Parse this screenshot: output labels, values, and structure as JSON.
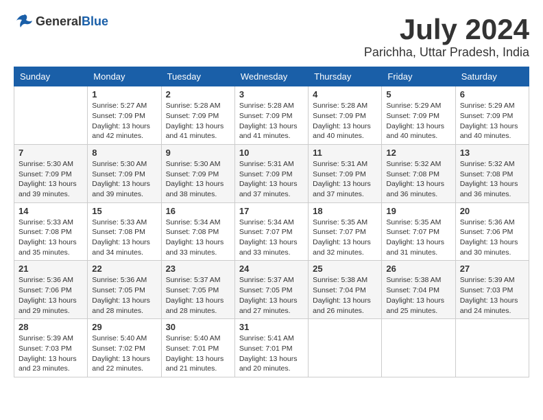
{
  "header": {
    "logo_general": "General",
    "logo_blue": "Blue",
    "month_year": "July 2024",
    "location": "Parichha, Uttar Pradesh, India"
  },
  "days_of_week": [
    "Sunday",
    "Monday",
    "Tuesday",
    "Wednesday",
    "Thursday",
    "Friday",
    "Saturday"
  ],
  "weeks": [
    [
      {
        "date": "",
        "sunrise": "",
        "sunset": "",
        "daylight": ""
      },
      {
        "date": "1",
        "sunrise": "Sunrise: 5:27 AM",
        "sunset": "Sunset: 7:09 PM",
        "daylight": "Daylight: 13 hours and 42 minutes."
      },
      {
        "date": "2",
        "sunrise": "Sunrise: 5:28 AM",
        "sunset": "Sunset: 7:09 PM",
        "daylight": "Daylight: 13 hours and 41 minutes."
      },
      {
        "date": "3",
        "sunrise": "Sunrise: 5:28 AM",
        "sunset": "Sunset: 7:09 PM",
        "daylight": "Daylight: 13 hours and 41 minutes."
      },
      {
        "date": "4",
        "sunrise": "Sunrise: 5:28 AM",
        "sunset": "Sunset: 7:09 PM",
        "daylight": "Daylight: 13 hours and 40 minutes."
      },
      {
        "date": "5",
        "sunrise": "Sunrise: 5:29 AM",
        "sunset": "Sunset: 7:09 PM",
        "daylight": "Daylight: 13 hours and 40 minutes."
      },
      {
        "date": "6",
        "sunrise": "Sunrise: 5:29 AM",
        "sunset": "Sunset: 7:09 PM",
        "daylight": "Daylight: 13 hours and 40 minutes."
      }
    ],
    [
      {
        "date": "7",
        "sunrise": "Sunrise: 5:30 AM",
        "sunset": "Sunset: 7:09 PM",
        "daylight": "Daylight: 13 hours and 39 minutes."
      },
      {
        "date": "8",
        "sunrise": "Sunrise: 5:30 AM",
        "sunset": "Sunset: 7:09 PM",
        "daylight": "Daylight: 13 hours and 39 minutes."
      },
      {
        "date": "9",
        "sunrise": "Sunrise: 5:30 AM",
        "sunset": "Sunset: 7:09 PM",
        "daylight": "Daylight: 13 hours and 38 minutes."
      },
      {
        "date": "10",
        "sunrise": "Sunrise: 5:31 AM",
        "sunset": "Sunset: 7:09 PM",
        "daylight": "Daylight: 13 hours and 37 minutes."
      },
      {
        "date": "11",
        "sunrise": "Sunrise: 5:31 AM",
        "sunset": "Sunset: 7:09 PM",
        "daylight": "Daylight: 13 hours and 37 minutes."
      },
      {
        "date": "12",
        "sunrise": "Sunrise: 5:32 AM",
        "sunset": "Sunset: 7:08 PM",
        "daylight": "Daylight: 13 hours and 36 minutes."
      },
      {
        "date": "13",
        "sunrise": "Sunrise: 5:32 AM",
        "sunset": "Sunset: 7:08 PM",
        "daylight": "Daylight: 13 hours and 36 minutes."
      }
    ],
    [
      {
        "date": "14",
        "sunrise": "Sunrise: 5:33 AM",
        "sunset": "Sunset: 7:08 PM",
        "daylight": "Daylight: 13 hours and 35 minutes."
      },
      {
        "date": "15",
        "sunrise": "Sunrise: 5:33 AM",
        "sunset": "Sunset: 7:08 PM",
        "daylight": "Daylight: 13 hours and 34 minutes."
      },
      {
        "date": "16",
        "sunrise": "Sunrise: 5:34 AM",
        "sunset": "Sunset: 7:08 PM",
        "daylight": "Daylight: 13 hours and 33 minutes."
      },
      {
        "date": "17",
        "sunrise": "Sunrise: 5:34 AM",
        "sunset": "Sunset: 7:07 PM",
        "daylight": "Daylight: 13 hours and 33 minutes."
      },
      {
        "date": "18",
        "sunrise": "Sunrise: 5:35 AM",
        "sunset": "Sunset: 7:07 PM",
        "daylight": "Daylight: 13 hours and 32 minutes."
      },
      {
        "date": "19",
        "sunrise": "Sunrise: 5:35 AM",
        "sunset": "Sunset: 7:07 PM",
        "daylight": "Daylight: 13 hours and 31 minutes."
      },
      {
        "date": "20",
        "sunrise": "Sunrise: 5:36 AM",
        "sunset": "Sunset: 7:06 PM",
        "daylight": "Daylight: 13 hours and 30 minutes."
      }
    ],
    [
      {
        "date": "21",
        "sunrise": "Sunrise: 5:36 AM",
        "sunset": "Sunset: 7:06 PM",
        "daylight": "Daylight: 13 hours and 29 minutes."
      },
      {
        "date": "22",
        "sunrise": "Sunrise: 5:36 AM",
        "sunset": "Sunset: 7:05 PM",
        "daylight": "Daylight: 13 hours and 28 minutes."
      },
      {
        "date": "23",
        "sunrise": "Sunrise: 5:37 AM",
        "sunset": "Sunset: 7:05 PM",
        "daylight": "Daylight: 13 hours and 28 minutes."
      },
      {
        "date": "24",
        "sunrise": "Sunrise: 5:37 AM",
        "sunset": "Sunset: 7:05 PM",
        "daylight": "Daylight: 13 hours and 27 minutes."
      },
      {
        "date": "25",
        "sunrise": "Sunrise: 5:38 AM",
        "sunset": "Sunset: 7:04 PM",
        "daylight": "Daylight: 13 hours and 26 minutes."
      },
      {
        "date": "26",
        "sunrise": "Sunrise: 5:38 AM",
        "sunset": "Sunset: 7:04 PM",
        "daylight": "Daylight: 13 hours and 25 minutes."
      },
      {
        "date": "27",
        "sunrise": "Sunrise: 5:39 AM",
        "sunset": "Sunset: 7:03 PM",
        "daylight": "Daylight: 13 hours and 24 minutes."
      }
    ],
    [
      {
        "date": "28",
        "sunrise": "Sunrise: 5:39 AM",
        "sunset": "Sunset: 7:03 PM",
        "daylight": "Daylight: 13 hours and 23 minutes."
      },
      {
        "date": "29",
        "sunrise": "Sunrise: 5:40 AM",
        "sunset": "Sunset: 7:02 PM",
        "daylight": "Daylight: 13 hours and 22 minutes."
      },
      {
        "date": "30",
        "sunrise": "Sunrise: 5:40 AM",
        "sunset": "Sunset: 7:01 PM",
        "daylight": "Daylight: 13 hours and 21 minutes."
      },
      {
        "date": "31",
        "sunrise": "Sunrise: 5:41 AM",
        "sunset": "Sunset: 7:01 PM",
        "daylight": "Daylight: 13 hours and 20 minutes."
      },
      {
        "date": "",
        "sunrise": "",
        "sunset": "",
        "daylight": ""
      },
      {
        "date": "",
        "sunrise": "",
        "sunset": "",
        "daylight": ""
      },
      {
        "date": "",
        "sunrise": "",
        "sunset": "",
        "daylight": ""
      }
    ]
  ]
}
